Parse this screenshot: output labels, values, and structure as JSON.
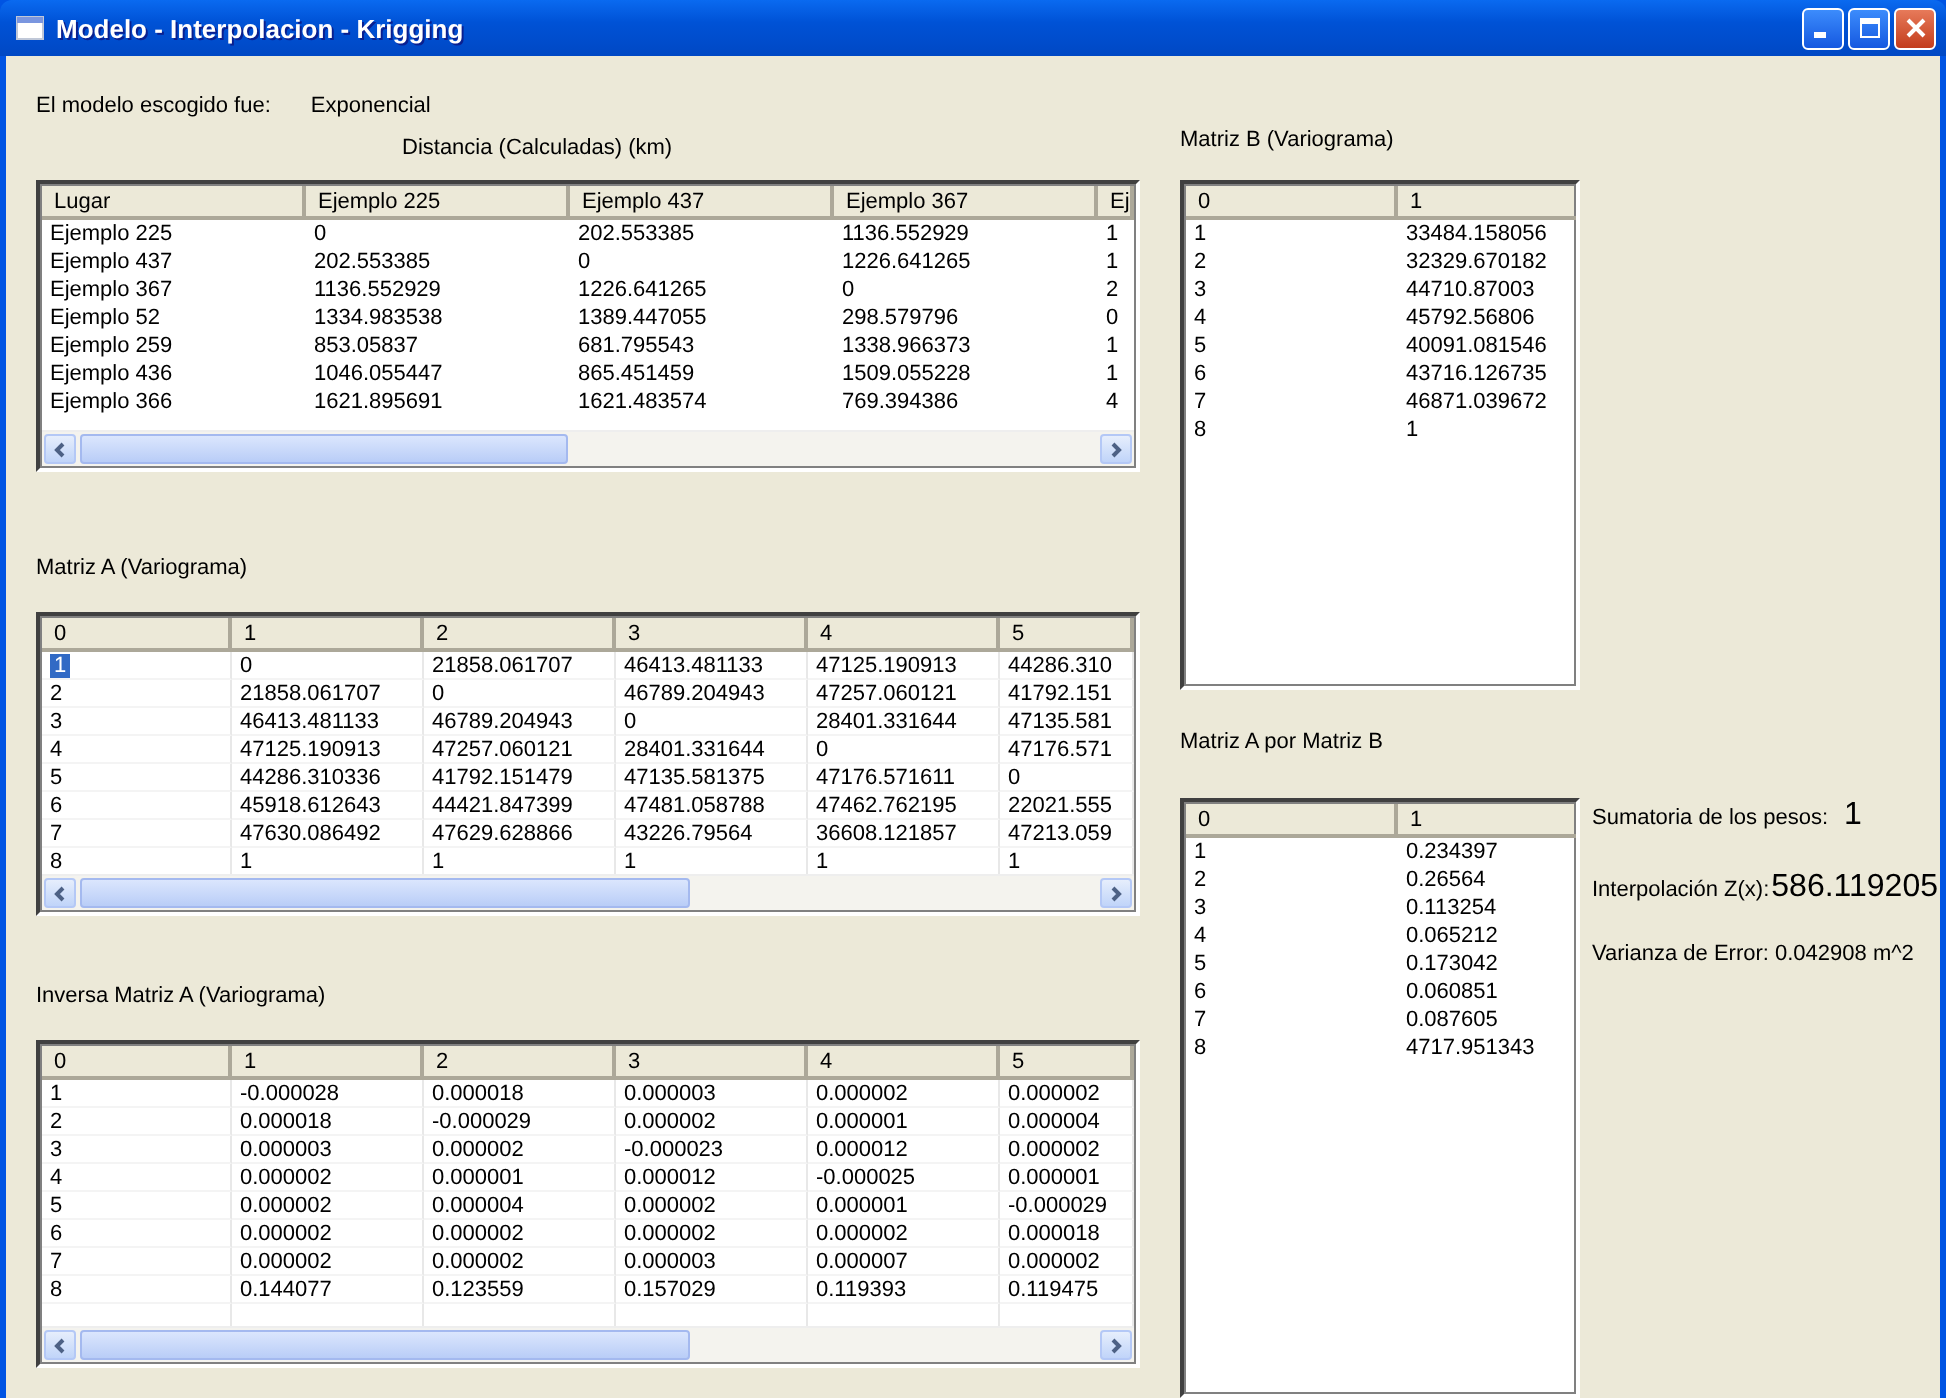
{
  "window": {
    "title": "Modelo - Interpolacion - Krigging"
  },
  "model": {
    "label": "El modelo escogido fue:",
    "value": "Exponencial"
  },
  "distance": {
    "title": "Distancia (Calculadas) (km)",
    "columns": [
      "Lugar",
      "Ejemplo 225",
      "Ejemplo 437",
      "Ejemplo 367",
      "Ej"
    ],
    "rows": [
      {
        "cells": [
          "Ejemplo 225",
          "0",
          "202.553385",
          "1136.552929",
          "1"
        ]
      },
      {
        "cells": [
          "Ejemplo 437",
          "202.553385",
          "0",
          "1226.641265",
          "1"
        ]
      },
      {
        "cells": [
          "Ejemplo 367",
          "1136.552929",
          "1226.641265",
          "0",
          "2"
        ]
      },
      {
        "cells": [
          "Ejemplo 52",
          "1334.983538",
          "1389.447055",
          "298.579796",
          "0"
        ]
      },
      {
        "cells": [
          "Ejemplo 259",
          "853.05837",
          "681.795543",
          "1338.966373",
          "1"
        ]
      },
      {
        "cells": [
          "Ejemplo 436",
          "1046.055447",
          "865.451459",
          "1509.055228",
          "1"
        ]
      },
      {
        "cells": [
          "Ejemplo 366",
          "1621.895691",
          "1621.483574",
          "769.394386",
          "4"
        ]
      }
    ]
  },
  "matrix_a": {
    "title": "Matriz A (Variograma)",
    "columns": [
      "0",
      "1",
      "2",
      "3",
      "4",
      "5"
    ],
    "rows": [
      {
        "selected": true,
        "cells": [
          "1",
          "0",
          "21858.061707",
          "46413.481133",
          "47125.190913",
          "44286.310"
        ]
      },
      {
        "selected": false,
        "cells": [
          "2",
          "21858.061707",
          "0",
          "46789.204943",
          "47257.060121",
          "41792.151"
        ]
      },
      {
        "selected": false,
        "cells": [
          "3",
          "46413.481133",
          "46789.204943",
          "0",
          "28401.331644",
          "47135.581"
        ]
      },
      {
        "selected": false,
        "cells": [
          "4",
          "47125.190913",
          "47257.060121",
          "28401.331644",
          "0",
          "47176.571"
        ]
      },
      {
        "selected": false,
        "cells": [
          "5",
          "44286.310336",
          "41792.151479",
          "47135.581375",
          "47176.571611",
          "0"
        ]
      },
      {
        "selected": false,
        "cells": [
          "6",
          "45918.612643",
          "44421.847399",
          "47481.058788",
          "47462.762195",
          "22021.555"
        ]
      },
      {
        "selected": false,
        "cells": [
          "7",
          "47630.086492",
          "47629.628866",
          "43226.79564",
          "36608.121857",
          "47213.059"
        ]
      },
      {
        "selected": false,
        "cells": [
          "8",
          "1",
          "1",
          "1",
          "1",
          "1"
        ]
      }
    ]
  },
  "inverse_a": {
    "title": "Inversa Matriz A (Variograma)",
    "columns": [
      "0",
      "1",
      "2",
      "3",
      "4",
      "5"
    ],
    "rows": [
      {
        "cells": [
          "1",
          "-0.000028",
          "0.000018",
          "0.000003",
          "0.000002",
          "0.000002"
        ]
      },
      {
        "cells": [
          "2",
          "0.000018",
          "-0.000029",
          "0.000002",
          "0.000001",
          "0.000004"
        ]
      },
      {
        "cells": [
          "3",
          "0.000003",
          "0.000002",
          "-0.000023",
          "0.000012",
          "0.000002"
        ]
      },
      {
        "cells": [
          "4",
          "0.000002",
          "0.000001",
          "0.000012",
          "-0.000025",
          "0.000001"
        ]
      },
      {
        "cells": [
          "5",
          "0.000002",
          "0.000004",
          "0.000002",
          "0.000001",
          "-0.000029"
        ]
      },
      {
        "cells": [
          "6",
          "0.000002",
          "0.000002",
          "0.000002",
          "0.000002",
          "0.000018"
        ]
      },
      {
        "cells": [
          "7",
          "0.000002",
          "0.000002",
          "0.000003",
          "0.000007",
          "0.000002"
        ]
      },
      {
        "cells": [
          "8",
          "0.144077",
          "0.123559",
          "0.157029",
          "0.119393",
          "0.119475"
        ]
      }
    ]
  },
  "matrix_b": {
    "title": "Matriz B (Variograma)",
    "columns": [
      "0",
      "1"
    ],
    "rows": [
      {
        "cells": [
          "1",
          "33484.158056"
        ]
      },
      {
        "cells": [
          "2",
          "32329.670182"
        ]
      },
      {
        "cells": [
          "3",
          "44710.87003"
        ]
      },
      {
        "cells": [
          "4",
          "45792.56806"
        ]
      },
      {
        "cells": [
          "5",
          "40091.081546"
        ]
      },
      {
        "cells": [
          "6",
          "43716.126735"
        ]
      },
      {
        "cells": [
          "7",
          "46871.039672"
        ]
      },
      {
        "cells": [
          "8",
          "1"
        ]
      }
    ]
  },
  "a_times_b": {
    "title": "Matriz A por Matriz B",
    "columns": [
      "0",
      "1"
    ],
    "rows": [
      {
        "cells": [
          "1",
          "0.234397"
        ]
      },
      {
        "cells": [
          "2",
          "0.26564"
        ]
      },
      {
        "cells": [
          "3",
          "0.113254"
        ]
      },
      {
        "cells": [
          "4",
          "0.065212"
        ]
      },
      {
        "cells": [
          "5",
          "0.173042"
        ]
      },
      {
        "cells": [
          "6",
          "0.060851"
        ]
      },
      {
        "cells": [
          "7",
          "0.087605"
        ]
      },
      {
        "cells": [
          "8",
          "4717.951343"
        ]
      }
    ]
  },
  "results": [
    {
      "kind": "pair",
      "label": "Sumatoria de los pesos:",
      "value": "1"
    },
    {
      "kind": "pair",
      "label": "Interpolación Z(x):",
      "value": "586.119205"
    },
    {
      "kind": "text",
      "text": "Varianza de Error: 0.042908 m^2"
    }
  ]
}
